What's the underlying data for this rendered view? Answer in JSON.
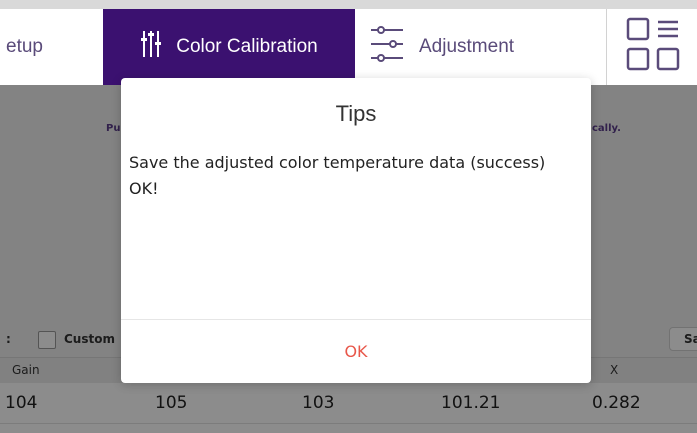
{
  "nav": {
    "tabs": [
      {
        "label": "etup",
        "icon": "setup-icon"
      },
      {
        "label": "Color Calibration",
        "icon": "sliders-icon"
      },
      {
        "label": "Adjustment",
        "icon": "adjust-sliders-icon"
      }
    ],
    "menu_icon": "grid-menu-icon",
    "active_color": "#3b1170"
  },
  "background": {
    "hint_left": "Pu",
    "hint_right": "cally.",
    "custom_label": "Custom",
    "custom_colon": ":",
    "save_label": "Sa"
  },
  "table": {
    "headers": [
      "Gain",
      "X"
    ],
    "row": [
      "104",
      "105",
      "103",
      "101.21",
      "0.282"
    ]
  },
  "dialog": {
    "title": "Tips",
    "message": "Save the adjusted color temperature data (success)",
    "message2": "OK!",
    "ok_label": "OK",
    "ok_color": "#e8574a"
  }
}
